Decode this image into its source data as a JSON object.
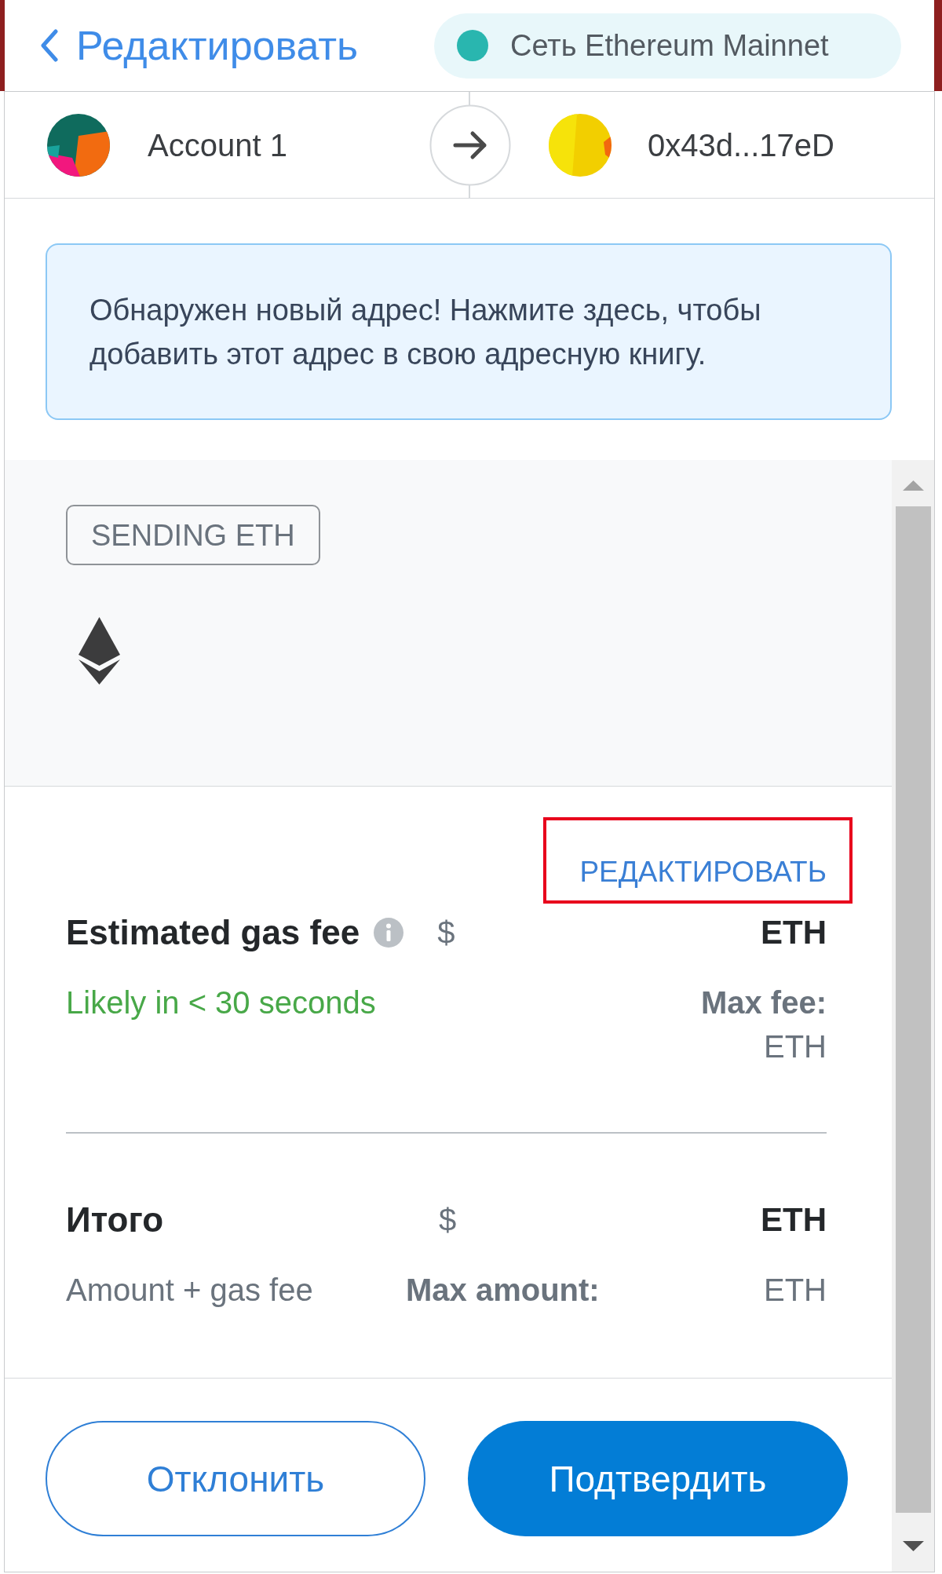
{
  "header": {
    "back_label": "Редактировать",
    "network": "Сеть Ethereum Mainnet"
  },
  "accounts": [
    {
      "name": "Account 1"
    },
    {
      "name": "0x43d...17eD"
    }
  ],
  "notice": {
    "text": "Обнаружен новый адрес! Нажмите здесь, чтобы добавить этот адрес в свою адресную книгу."
  },
  "summary": {
    "action_badge": "SENDING ETH"
  },
  "details": {
    "edit_link": {
      "label": "РЕДАКТИРОВАТЬ",
      "highlighted": true
    },
    "gas_fee": {
      "label": "Estimated gas fee",
      "fiat": "$",
      "eth": "ETH",
      "timing": "Likely in < 30 seconds",
      "max_label": "Max fee:",
      "max_eth": "ETH"
    },
    "total": {
      "label": "Итого",
      "fiat": "$",
      "eth": "ETH",
      "sublabel": "Amount + gas fee",
      "max_label": "Max amount:",
      "max_eth": "ETH"
    }
  },
  "buttons": [
    {
      "label": "Отклонить",
      "kind": "secondary"
    },
    {
      "label": "Подтвердить",
      "kind": "primary"
    }
  ]
}
